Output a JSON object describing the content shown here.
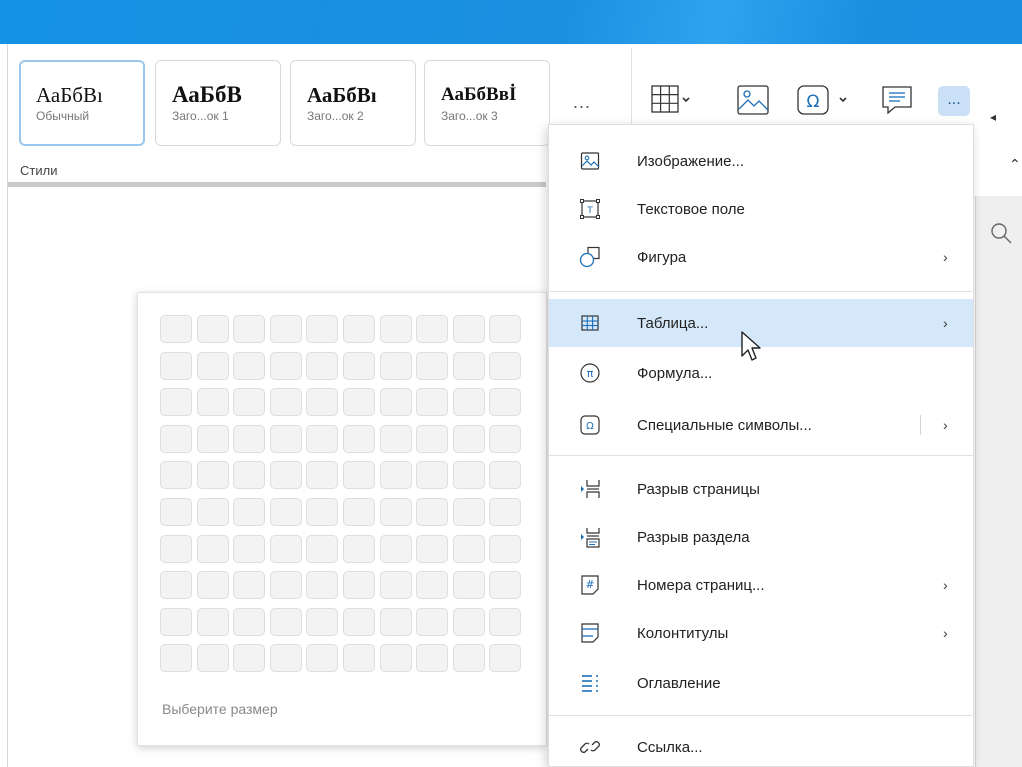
{
  "ribbon": {
    "styles": [
      {
        "sample": "АаБбВı",
        "name": "Обычный",
        "selected": true
      },
      {
        "sample": "АаБбВ",
        "name": "Заго...ок 1",
        "selected": false
      },
      {
        "sample": "АаБбВı",
        "name": "Заго...ок 2",
        "selected": false
      },
      {
        "sample": "АаБбВвİ",
        "name": "Заго...ок 3",
        "selected": false
      }
    ],
    "more_styles": "...",
    "group_label": "Стили",
    "toolbar_icons": [
      "table-icon",
      "image-icon",
      "omega-icon",
      "comment-icon",
      "more-icon"
    ],
    "more_label": "..."
  },
  "table_picker": {
    "rows": 10,
    "cols": 10,
    "hint": "Выберите размер"
  },
  "insert_menu": {
    "items": [
      {
        "label": "Изображение...",
        "icon": "image-icon",
        "submenu": false
      },
      {
        "label": "Текстовое поле",
        "icon": "text-box-icon",
        "submenu": false
      },
      {
        "label": "Фигура",
        "icon": "shape-icon",
        "submenu": true
      },
      {
        "label": "Таблица...",
        "icon": "table-icon",
        "submenu": true,
        "highlighted": true
      },
      {
        "label": "Формула...",
        "icon": "formula-icon",
        "submenu": false
      },
      {
        "label": "Специальные символы...",
        "icon": "special-chars-icon",
        "submenu": true
      },
      {
        "label": "Разрыв страницы",
        "icon": "page-break-icon",
        "submenu": false
      },
      {
        "label": "Разрыв раздела",
        "icon": "section-break-icon",
        "submenu": false
      },
      {
        "label": "Номера страниц...",
        "icon": "page-numbers-icon",
        "submenu": true
      },
      {
        "label": "Колонтитулы",
        "icon": "header-footer-icon",
        "submenu": true
      },
      {
        "label": "Оглавление",
        "icon": "toc-icon",
        "submenu": false
      },
      {
        "label": "Ссылка...",
        "icon": "link-icon",
        "submenu": false
      }
    ]
  },
  "colors": {
    "titlebar": "#1a8fe2",
    "highlight": "#d5e8fa",
    "accent": "#1d6fb8"
  }
}
